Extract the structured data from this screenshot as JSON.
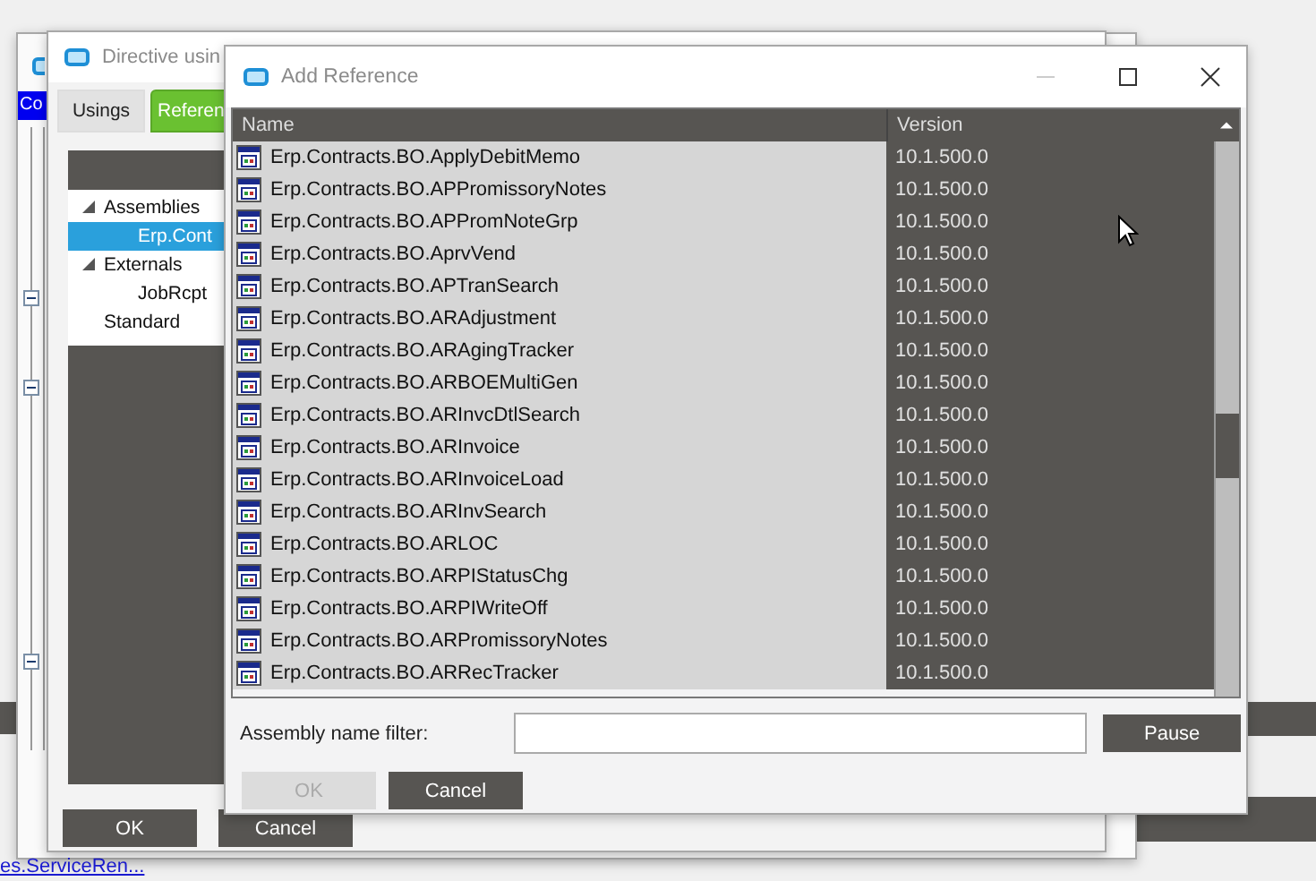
{
  "back_window": {
    "menu_label": "Co",
    "link": "es.ServiceRen..."
  },
  "directive_window": {
    "title": "Directive usin",
    "tabs": [
      {
        "label": "Usings",
        "selected": false
      },
      {
        "label": "Referen",
        "selected": true
      }
    ],
    "tree": [
      {
        "label": "Assemblies",
        "expanded": true,
        "selected": false,
        "children": [
          {
            "label": "Erp.Cont",
            "selected": true
          }
        ]
      },
      {
        "label": "Externals",
        "expanded": true,
        "selected": false,
        "children": [
          {
            "label": "JobRcpt",
            "selected": false
          }
        ]
      },
      {
        "label": "Standard",
        "selected": false
      }
    ],
    "buttons": [
      {
        "label": "OK"
      },
      {
        "label": "Cancel"
      }
    ]
  },
  "dialog": {
    "title": "Add Reference",
    "table": {
      "columns": [
        "Name",
        "Version"
      ],
      "rows": [
        {
          "name": "Erp.Contracts.BO.ApplyDebitMemo",
          "version": "10.1.500.0"
        },
        {
          "name": "Erp.Contracts.BO.APPromissoryNotes",
          "version": "10.1.500.0"
        },
        {
          "name": "Erp.Contracts.BO.APPromNoteGrp",
          "version": "10.1.500.0"
        },
        {
          "name": "Erp.Contracts.BO.AprvVend",
          "version": "10.1.500.0"
        },
        {
          "name": "Erp.Contracts.BO.APTranSearch",
          "version": "10.1.500.0"
        },
        {
          "name": "Erp.Contracts.BO.ARAdjustment",
          "version": "10.1.500.0"
        },
        {
          "name": "Erp.Contracts.BO.ARAgingTracker",
          "version": "10.1.500.0"
        },
        {
          "name": "Erp.Contracts.BO.ARBOEMultiGen",
          "version": "10.1.500.0"
        },
        {
          "name": "Erp.Contracts.BO.ARInvcDtlSearch",
          "version": "10.1.500.0"
        },
        {
          "name": "Erp.Contracts.BO.ARInvoice",
          "version": "10.1.500.0"
        },
        {
          "name": "Erp.Contracts.BO.ARInvoiceLoad",
          "version": "10.1.500.0"
        },
        {
          "name": "Erp.Contracts.BO.ARInvSearch",
          "version": "10.1.500.0"
        },
        {
          "name": "Erp.Contracts.BO.ARLOC",
          "version": "10.1.500.0"
        },
        {
          "name": "Erp.Contracts.BO.ARPIStatusChg",
          "version": "10.1.500.0"
        },
        {
          "name": "Erp.Contracts.BO.ARPIWriteOff",
          "version": "10.1.500.0"
        },
        {
          "name": "Erp.Contracts.BO.ARPromissoryNotes",
          "version": "10.1.500.0"
        },
        {
          "name": "Erp.Contracts.BO.ARRecTracker",
          "version": "10.1.500.0"
        }
      ]
    },
    "filter": {
      "label": "Assembly name filter:"
    },
    "pause_button": "Pause",
    "buttons": [
      {
        "label": "OK",
        "disabled": true
      },
      {
        "label": "Cancel",
        "disabled": false
      }
    ]
  }
}
